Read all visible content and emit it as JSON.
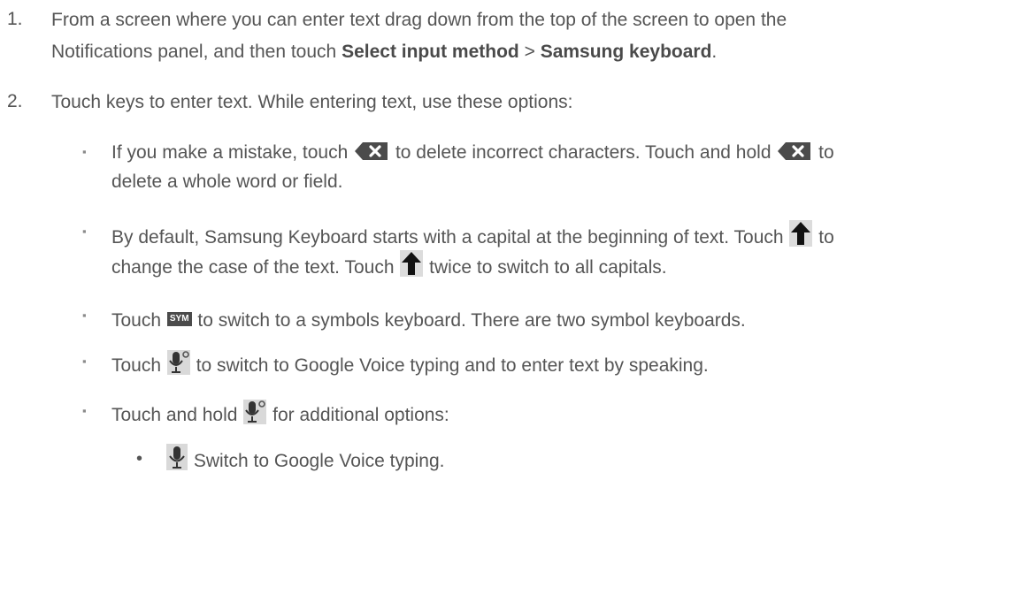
{
  "steps": [
    {
      "number": "1.",
      "line1": "From a screen where you can enter text drag down from the top of the screen to open the",
      "line2_pre": "Notifications panel, and then touch ",
      "bold1": "Select input method",
      "sep": " > ",
      "bold2": "Samsung keyboard",
      "end": "."
    },
    {
      "number": "2.",
      "line1": "Touch keys to enter text. While entering text, use these options:"
    }
  ],
  "bullets": [
    {
      "a1": "If you make a mistake, touch ",
      "a2": " to delete incorrect characters. Touch and hold ",
      "a3": " to",
      "b1": "delete a whole word or field."
    },
    {
      "a1": "By default, Samsung Keyboard starts with a capital at the beginning of text. Touch ",
      "a2": " to",
      "b1": "change the case of the text. Touch ",
      "b2": " twice to switch to all capitals."
    },
    {
      "a1": "Touch ",
      "a2": " to switch to a symbols keyboard. There are two symbol keyboards.",
      "sym_label": "SYM"
    },
    {
      "a1": "Touch ",
      "a2": " to switch to Google Voice typing and to enter text by speaking."
    },
    {
      "a1": "Touch and hold ",
      "a2": " for additional options:"
    }
  ],
  "subbullets": [
    {
      "text": " Switch to Google Voice typing."
    }
  ],
  "icons": {
    "delete": "backspace-icon",
    "shift": "shift-arrow-icon",
    "sym": "sym-key-icon",
    "voice_settings": "microphone-settings-icon",
    "voice": "microphone-icon"
  }
}
